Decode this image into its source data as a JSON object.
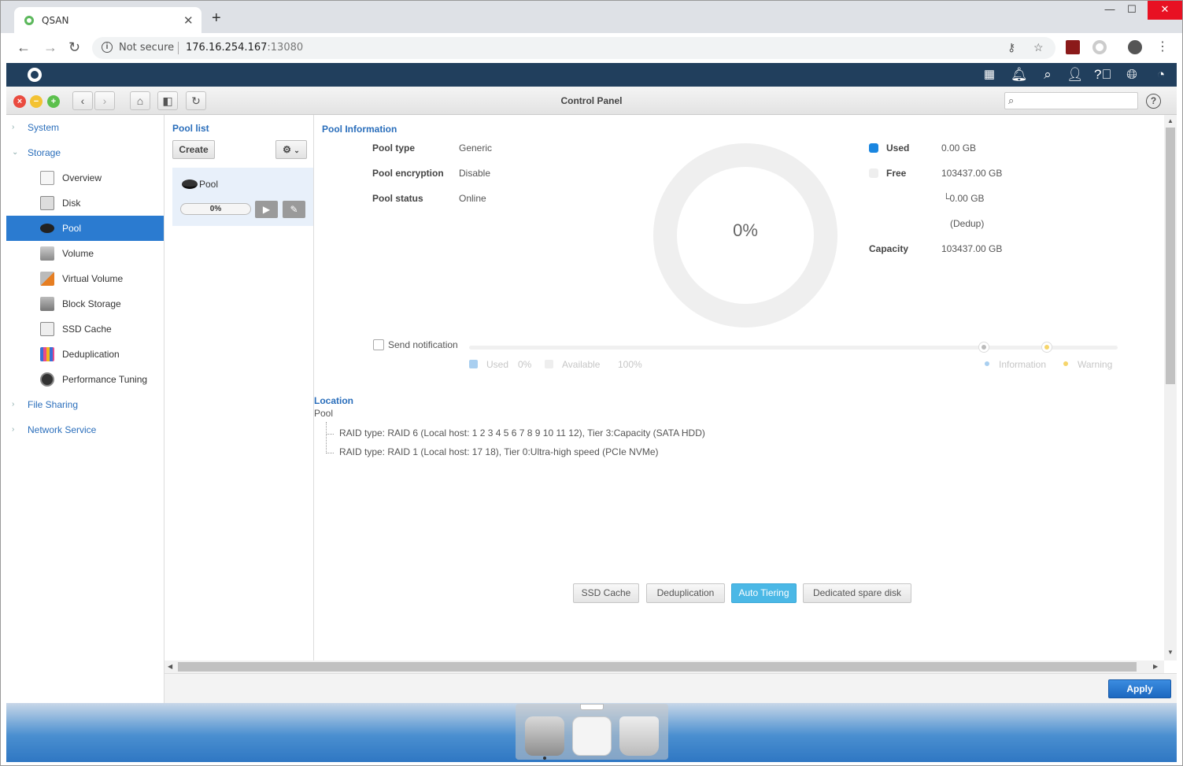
{
  "browser": {
    "tab_title": "QSAN",
    "security_label": "Not secure",
    "url_host": "176.16.254.167",
    "url_port": ":13080"
  },
  "window": {
    "title": "Control Panel",
    "search_placeholder": ""
  },
  "sidebar": {
    "top_items": [
      {
        "label": "System"
      },
      {
        "label": "Storage"
      },
      {
        "label": "File Sharing"
      },
      {
        "label": "Network Service"
      }
    ],
    "storage_items": [
      {
        "label": "Overview",
        "icon": "overview-icon"
      },
      {
        "label": "Disk",
        "icon": "disk-icon"
      },
      {
        "label": "Pool",
        "icon": "pool-icon",
        "active": true
      },
      {
        "label": "Volume",
        "icon": "volume-icon"
      },
      {
        "label": "Virtual Volume",
        "icon": "virtual-volume-icon"
      },
      {
        "label": "Block Storage",
        "icon": "block-storage-icon"
      },
      {
        "label": "SSD Cache",
        "icon": "ssd-cache-icon"
      },
      {
        "label": "Deduplication",
        "icon": "deduplication-icon"
      },
      {
        "label": "Performance Tuning",
        "icon": "performance-tuning-icon"
      }
    ]
  },
  "pool_list": {
    "title": "Pool list",
    "create_label": "Create",
    "pool_name": "Pool",
    "progress": "0%",
    "progress_value": 0
  },
  "pool_info": {
    "title": "Pool Information",
    "rows": [
      {
        "label": "Pool type",
        "value": "Generic"
      },
      {
        "label": "Pool encryption",
        "value": "Disable"
      },
      {
        "label": "Pool status",
        "value": "Online"
      }
    ],
    "donut_label": "0%",
    "used_label": "Used",
    "used_value": "0.00 GB",
    "free_label": "Free",
    "free_value": "103437.00 GB",
    "dedup_value": "└0.00 GB",
    "dedup_note": "(Dedup)",
    "capacity_label": "Capacity",
    "capacity_value": "103437.00 GB",
    "colors": {
      "used": "#1a86e0",
      "free": "#eeeeee"
    }
  },
  "notification": {
    "checkbox_label": "Send notification",
    "used_label": "Used",
    "used_pct": "0%",
    "available_label": "Available",
    "available_pct": "100%",
    "information_label": "Information",
    "warning_label": "Warning"
  },
  "location": {
    "title": "Location",
    "root": "Pool",
    "entries": [
      "RAID type: RAID 6 (Local host: 1 2 3 4 5 6 7 8 9 10 11 12), Tier 3:Capacity (SATA HDD)",
      "RAID type: RAID 1 (Local host: 17 18), Tier 0:Ultra-high speed (PCIe NVMe)"
    ]
  },
  "actions": {
    "ssd_cache": "SSD Cache",
    "deduplication": "Deduplication",
    "auto_tiering": "Auto Tiering",
    "dedicated_spare": "Dedicated spare disk"
  },
  "footer": {
    "apply_label": "Apply"
  }
}
